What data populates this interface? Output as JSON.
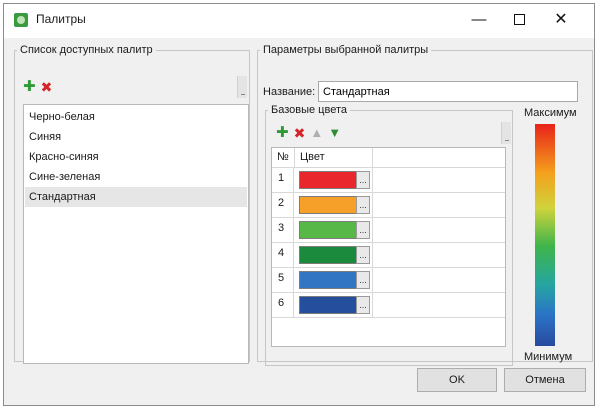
{
  "window": {
    "title": "Палитры",
    "minimize_glyph": "—",
    "close_glyph": "✕"
  },
  "available_palettes": {
    "legend": "Список доступных палитр",
    "items": [
      {
        "label": "Черно-белая",
        "selected": false
      },
      {
        "label": "Синяя",
        "selected": false
      },
      {
        "label": "Красно-синяя",
        "selected": false
      },
      {
        "label": "Сине-зеленая",
        "selected": false
      },
      {
        "label": "Стандартная",
        "selected": true
      }
    ]
  },
  "selected_palette": {
    "legend": "Параметры выбранной палитры",
    "name_label": "Название:",
    "name_value": "Стандартная",
    "base_colors": {
      "legend": "Базовые цвета",
      "column_no": "№",
      "column_color": "Цвет",
      "rows": [
        {
          "no": "1",
          "color": "#e8262b"
        },
        {
          "no": "2",
          "color": "#f6a02a"
        },
        {
          "no": "3",
          "color": "#57b847"
        },
        {
          "no": "4",
          "color": "#1c8a3c"
        },
        {
          "no": "5",
          "color": "#3276c3"
        },
        {
          "no": "6",
          "color": "#254e9d"
        }
      ],
      "browse_label": "..."
    },
    "gradient": {
      "max_label": "Максимум",
      "min_label": "Минимум"
    }
  },
  "buttons": {
    "ok": "OK",
    "cancel": "Отмена"
  },
  "icons": {
    "add": "add-icon",
    "delete": "delete-icon",
    "move_up": "arrow-up-icon",
    "move_down": "arrow-down-icon"
  }
}
